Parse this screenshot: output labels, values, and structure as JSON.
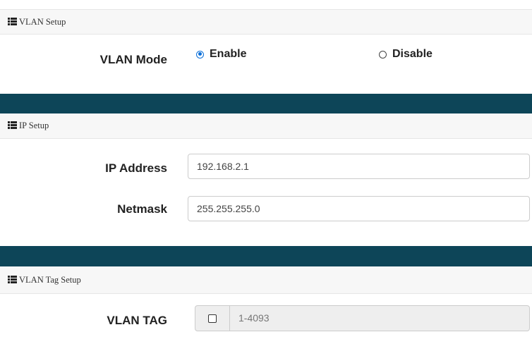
{
  "vlan_setup": {
    "title": "VLAN Setup",
    "mode_label": "VLAN Mode",
    "options": [
      {
        "label": "Enable",
        "checked": true
      },
      {
        "label": "Disable",
        "checked": false
      }
    ]
  },
  "ip_setup": {
    "title": "IP Setup",
    "ip_address_label": "IP Address",
    "ip_address_value": "192.168.2.1",
    "netmask_label": "Netmask",
    "netmask_value": "255.255.255.0"
  },
  "vlan_tag_setup": {
    "title": "VLAN Tag Setup",
    "tag_label": "VLAN TAG",
    "tag_checked": false,
    "tag_placeholder": "1-4093"
  },
  "icons": {
    "section_icon": "list-icon"
  },
  "colors": {
    "divider": "#0d4558",
    "header_bg": "#f7f7f7",
    "radio_accent": "#0b6fd8"
  }
}
